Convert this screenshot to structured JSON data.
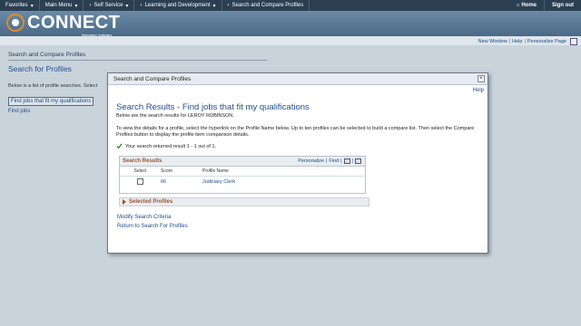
{
  "topnav": {
    "menus": [
      "Favorites",
      "Main Menu",
      "Self Service",
      "Learning and Development",
      "Search and Compare Profiles"
    ],
    "home": "Home",
    "signout": "Sign out"
  },
  "logo": {
    "text": "CONNECT",
    "sub": "Maryland Judiciary"
  },
  "utility": {
    "new_window": "New Window",
    "help": "Help",
    "personalize": "Personalize Page"
  },
  "page": {
    "crumb": "Search and Compare Profiles",
    "title": "Search for Profiles",
    "desc": "Below is a list of profile searches.  Select",
    "link1": "Find jobs that fit my qualifications",
    "link2": "Find jobs"
  },
  "modal": {
    "title": "Search and Compare Profiles",
    "help": "Help",
    "heading": "Search Results - Find jobs that fit my qualifications",
    "sub": "Below are the search results for LEROY ROBINSON.",
    "instructions": "To view the details for a profile, select the hyperlink on the Profile Name below. Up to ten profiles can be selected to build a compare list. Then select the Compare Profiles button to display the profile item comparison details.",
    "result_msg": "Your search returned result 1 - 1 out of 1.",
    "grid": {
      "title": "Search Results",
      "personalize": "Personalize",
      "find": "Find",
      "columns": [
        "Select",
        "Score",
        "Profile Name"
      ],
      "rows": [
        {
          "score": "66",
          "name": "Judiciary Clerk"
        }
      ]
    },
    "selected_profiles": "Selected Profiles",
    "modify": "Modify Search Criteria",
    "return": "Return to Search For Profiles"
  },
  "colors": {
    "nav": "#2b3f52",
    "accent_link": "#1a4a8a",
    "section_title": "#a0522d"
  }
}
